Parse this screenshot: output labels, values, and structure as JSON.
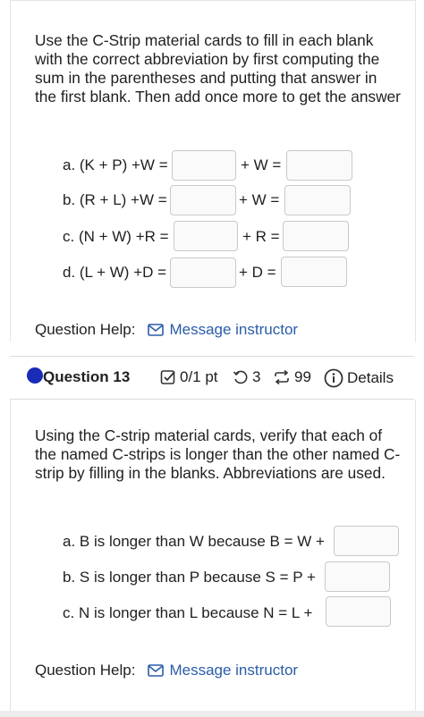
{
  "q12": {
    "prompt": "Use the C-Strip material cards to fill in each blank with the correct abbreviation by first computing the sum in the parentheses and putting that answer in the first blank.  Then add once more to get the answer",
    "lines": [
      {
        "label": "a. (K + P) +W =",
        "mid": "+ W ="
      },
      {
        "label": "b. (R + L) +W =",
        "mid": "+ W ="
      },
      {
        "label": "c. (N + W) +R =",
        "mid": "+ R ="
      },
      {
        "label": "d. (L + W) +D =",
        "mid": "+ D ="
      }
    ],
    "help_label": "Question Help:",
    "message_link": "Message instructor"
  },
  "q13": {
    "title": "Question 13",
    "points": "0/1 pt",
    "retries": "3",
    "attempts": "99",
    "details": "Details",
    "prompt": "Using the C-strip material cards, verify that each of the named C-strips is longer than the other named C-strip by filling in the blanks.  Abbreviations are used.",
    "lines": [
      {
        "label": "a. B is longer than W because B = W +"
      },
      {
        "label": "b. S is longer than P because S = P +"
      },
      {
        "label": "c. N is longer than L because N = L +"
      }
    ],
    "help_label": "Question Help:",
    "message_link": "Message instructor"
  },
  "colors": {
    "accent": "#2a5ca8",
    "dot": "#1a2bb8"
  },
  "icons": [
    "mail-icon",
    "checkbox-icon",
    "undo-icon",
    "repeat-icon",
    "info-icon"
  ]
}
